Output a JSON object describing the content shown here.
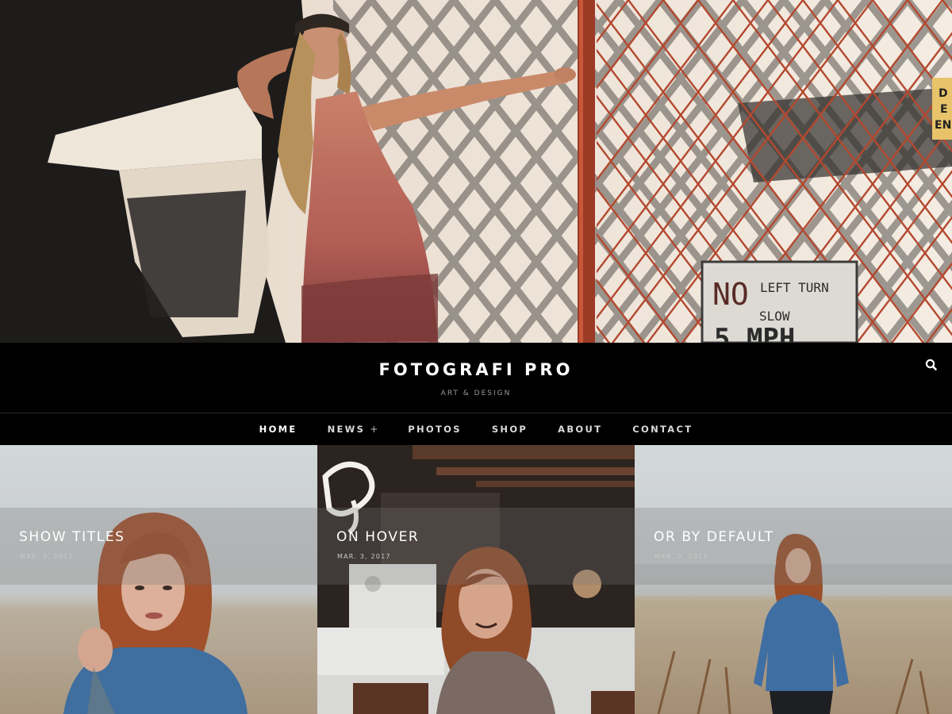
{
  "site": {
    "title": "FOTOGRAFI PRO",
    "tagline": "ART & DESIGN"
  },
  "hero": {
    "sign_line1_a": "NO",
    "sign_line1_b": "LEFT TURN",
    "sign_line2": "SLOW",
    "sign_line3": "5 MPH",
    "side_sign": "D\nE\nEN"
  },
  "nav": {
    "items": [
      {
        "label": "HOME",
        "active": true,
        "has_submenu": false
      },
      {
        "label": "NEWS",
        "active": false,
        "has_submenu": true,
        "submenu_indicator": "+"
      },
      {
        "label": "PHOTOS",
        "active": false,
        "has_submenu": false
      },
      {
        "label": "SHOP",
        "active": false,
        "has_submenu": false
      },
      {
        "label": "ABOUT",
        "active": false,
        "has_submenu": false
      },
      {
        "label": "CONTACT",
        "active": false,
        "has_submenu": false
      }
    ]
  },
  "posts": [
    {
      "title": "SHOW TITLES",
      "date": "MAR. 3, 2017"
    },
    {
      "title": "ON HOVER",
      "date": "MAR. 3, 2017"
    },
    {
      "title": "OR BY DEFAULT",
      "date": "MAR. 3, 2017"
    }
  ],
  "icons": {
    "search": "search-icon"
  },
  "colors": {
    "header_bg": "#000000",
    "nav_text": "#d9d9d9",
    "tagline": "#9a9a9a",
    "gate_red": "#b5452f"
  }
}
